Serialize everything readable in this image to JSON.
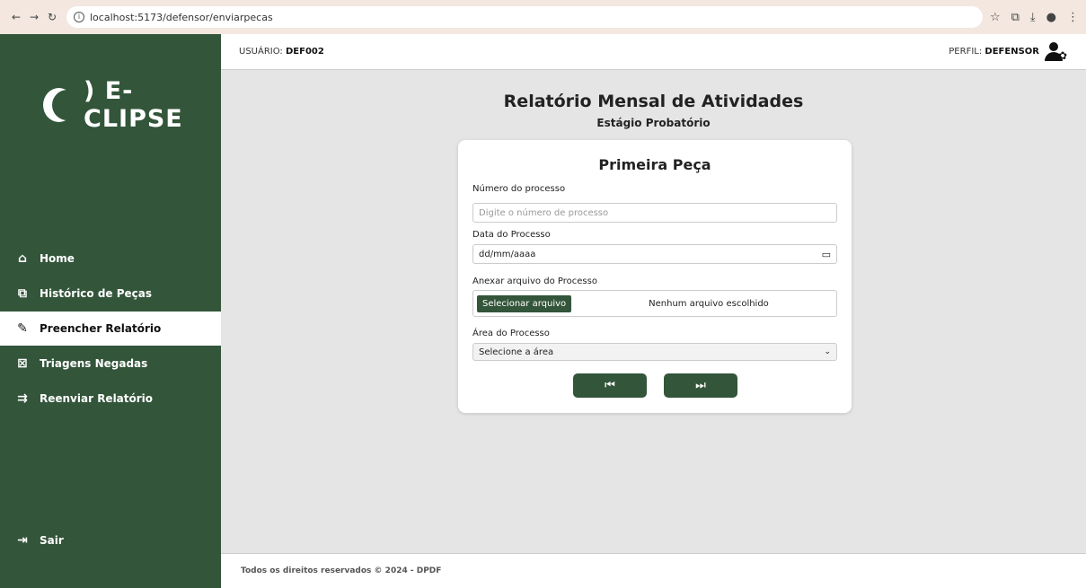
{
  "browser": {
    "url": "localhost:5173/defensor/enviarpecas"
  },
  "header": {
    "user_prefix": "USUÁRIO:",
    "user_value": "DEF002",
    "profile_prefix": "PERFIL:",
    "profile_value": "DEFENSOR"
  },
  "sidebar": {
    "logo_text": ") E-CLIPSE",
    "items": [
      {
        "label": "Home",
        "icon": "home-icon"
      },
      {
        "label": "Histórico de Peças",
        "icon": "copy-icon"
      },
      {
        "label": "Preencher Relatório",
        "icon": "edit-icon"
      },
      {
        "label": "Triagens Negadas",
        "icon": "archive-x-icon"
      },
      {
        "label": "Reenviar Relatório",
        "icon": "resend-icon"
      }
    ],
    "logout": "Sair"
  },
  "main": {
    "title": "Relatório Mensal de Atividades",
    "subtitle": "Estágio Probatório"
  },
  "form": {
    "title": "Primeira Peça",
    "process_number_label": "Número do processo",
    "process_number_placeholder": "Digite o número de processo",
    "date_label": "Data do Processo",
    "date_value": "dd/mm/aaaa",
    "file_label": "Anexar arquivo do Processo",
    "file_button": "Selecionar arquivo",
    "file_status": "Nenhum arquivo escolhido",
    "area_label": "Área do Processo",
    "area_selected": "Selecione a área"
  },
  "footer": {
    "text": "Todos os direitos reservados © 2024 - DPDF"
  }
}
